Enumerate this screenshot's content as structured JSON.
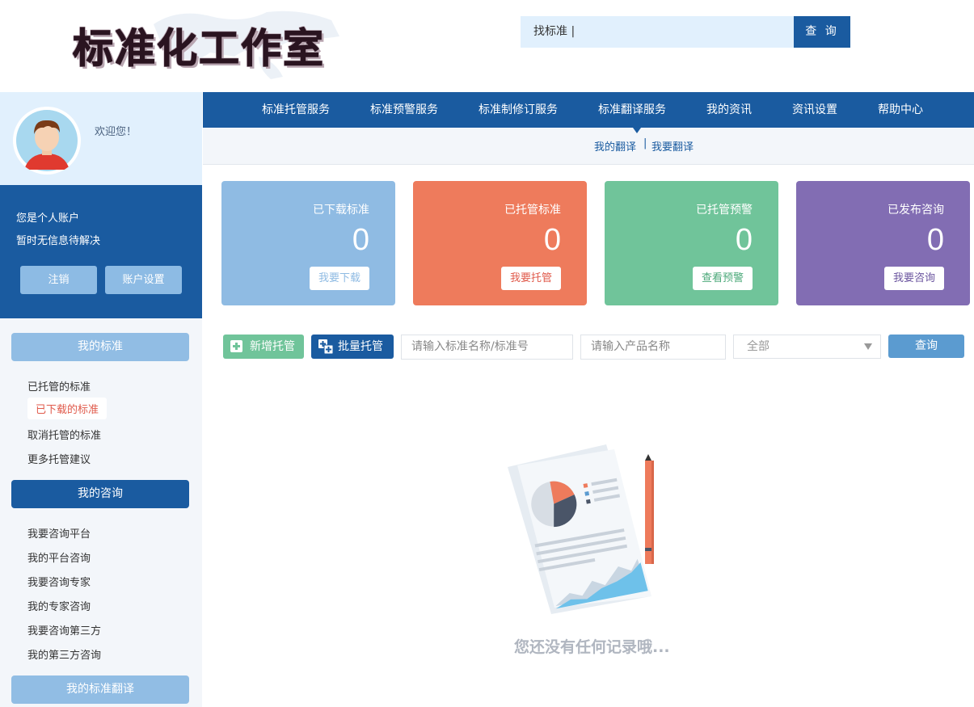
{
  "header": {
    "logo_text": "标准化工作室",
    "search_value": "找标准 |",
    "search_button": "查 询"
  },
  "profile": {
    "welcome": "欢迎您！"
  },
  "account": {
    "line1": "您是个人账户",
    "line2": "暂时无信息待解决",
    "logout": "注销",
    "settings": "账户设置"
  },
  "sidebar": {
    "group1": {
      "title": "我的标准",
      "items": [
        "已托管的标准",
        "已下载的标准",
        "取消托管的标准",
        "更多托管建议"
      ]
    },
    "group2": {
      "title": "我的咨询",
      "items": [
        "我要咨询平台",
        "我的平台咨询",
        "我要咨询专家",
        "我的专家咨询",
        "我要咨询第三方",
        "我的第三方咨询"
      ]
    },
    "group3": {
      "title": "我的标准翻译"
    }
  },
  "nav": {
    "items": [
      "标准托管服务",
      "标准预警服务",
      "标准制修订服务",
      "标准翻译服务",
      "我的资讯",
      "资讯设置",
      "帮助中心"
    ],
    "sub": [
      "我的翻译",
      "我要翻译"
    ],
    "sub_sep": "|"
  },
  "cards": [
    {
      "title": "已下载标准",
      "value": "0",
      "button": "我要下载",
      "color": "#8fbbe3",
      "btn_color": "#8fbbe3"
    },
    {
      "title": "已托管标准",
      "value": "0",
      "button": "我要托管",
      "color": "#ee7b5c",
      "btn_color": "#e05a4b"
    },
    {
      "title": "已托管预警",
      "value": "0",
      "button": "查看预警",
      "color": "#70c49a",
      "btn_color": "#4aa878"
    },
    {
      "title": "已发布咨询",
      "value": "0",
      "button": "我要咨询",
      "color": "#826db3",
      "btn_color": "#6b559f"
    }
  ],
  "toolbar": {
    "add_label": "新增托管",
    "batch_label": "批量托管",
    "std_placeholder": "请输入标准名称/标准号",
    "product_placeholder": "请输入产品名称",
    "select_value": "全部",
    "query_label": "查询"
  },
  "empty": {
    "message": "您还没有任何记录哦..."
  }
}
